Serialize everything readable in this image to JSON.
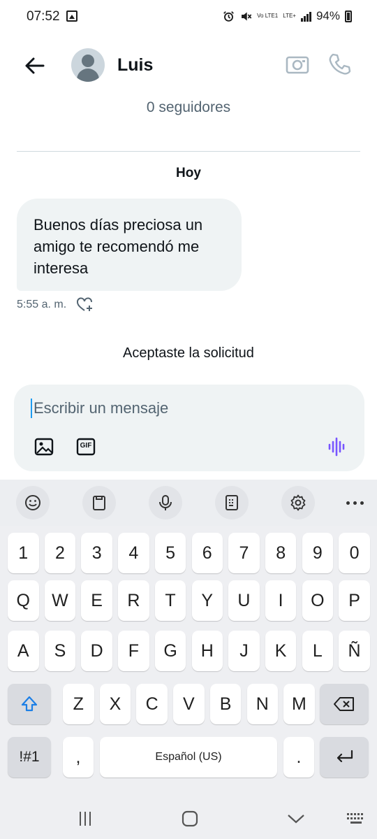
{
  "status_bar": {
    "time": "07:52",
    "network_label": "LTE+",
    "volte_label": "Vo LTE1",
    "battery": "94%"
  },
  "header": {
    "contact_name": "Luis",
    "followers": "0 seguidores"
  },
  "conversation": {
    "day_label": "Hoy",
    "messages": [
      {
        "text": "Buenos días preciosa un amigo te recomendó me interesa",
        "time": "5:55 a. m."
      }
    ],
    "system_message": "Aceptaste la solicitud"
  },
  "composer": {
    "placeholder": "Escribir un mensaje",
    "gif_label": "GIF"
  },
  "keyboard": {
    "rows": [
      [
        "1",
        "2",
        "3",
        "4",
        "5",
        "6",
        "7",
        "8",
        "9",
        "0"
      ],
      [
        "Q",
        "W",
        "E",
        "R",
        "T",
        "Y",
        "U",
        "I",
        "O",
        "P"
      ],
      [
        "A",
        "S",
        "D",
        "F",
        "G",
        "H",
        "J",
        "K",
        "L",
        "Ñ"
      ],
      [
        "Z",
        "X",
        "C",
        "V",
        "B",
        "N",
        "M"
      ]
    ],
    "symbols_label": "!#1",
    "comma_label": ",",
    "space_label": "Español (US)",
    "period_label": "."
  },
  "colors": {
    "accent": "#1d9bf0",
    "voice_purple": "#7856ff",
    "bubble_bg": "#eff3f4",
    "muted_text": "#536471"
  }
}
